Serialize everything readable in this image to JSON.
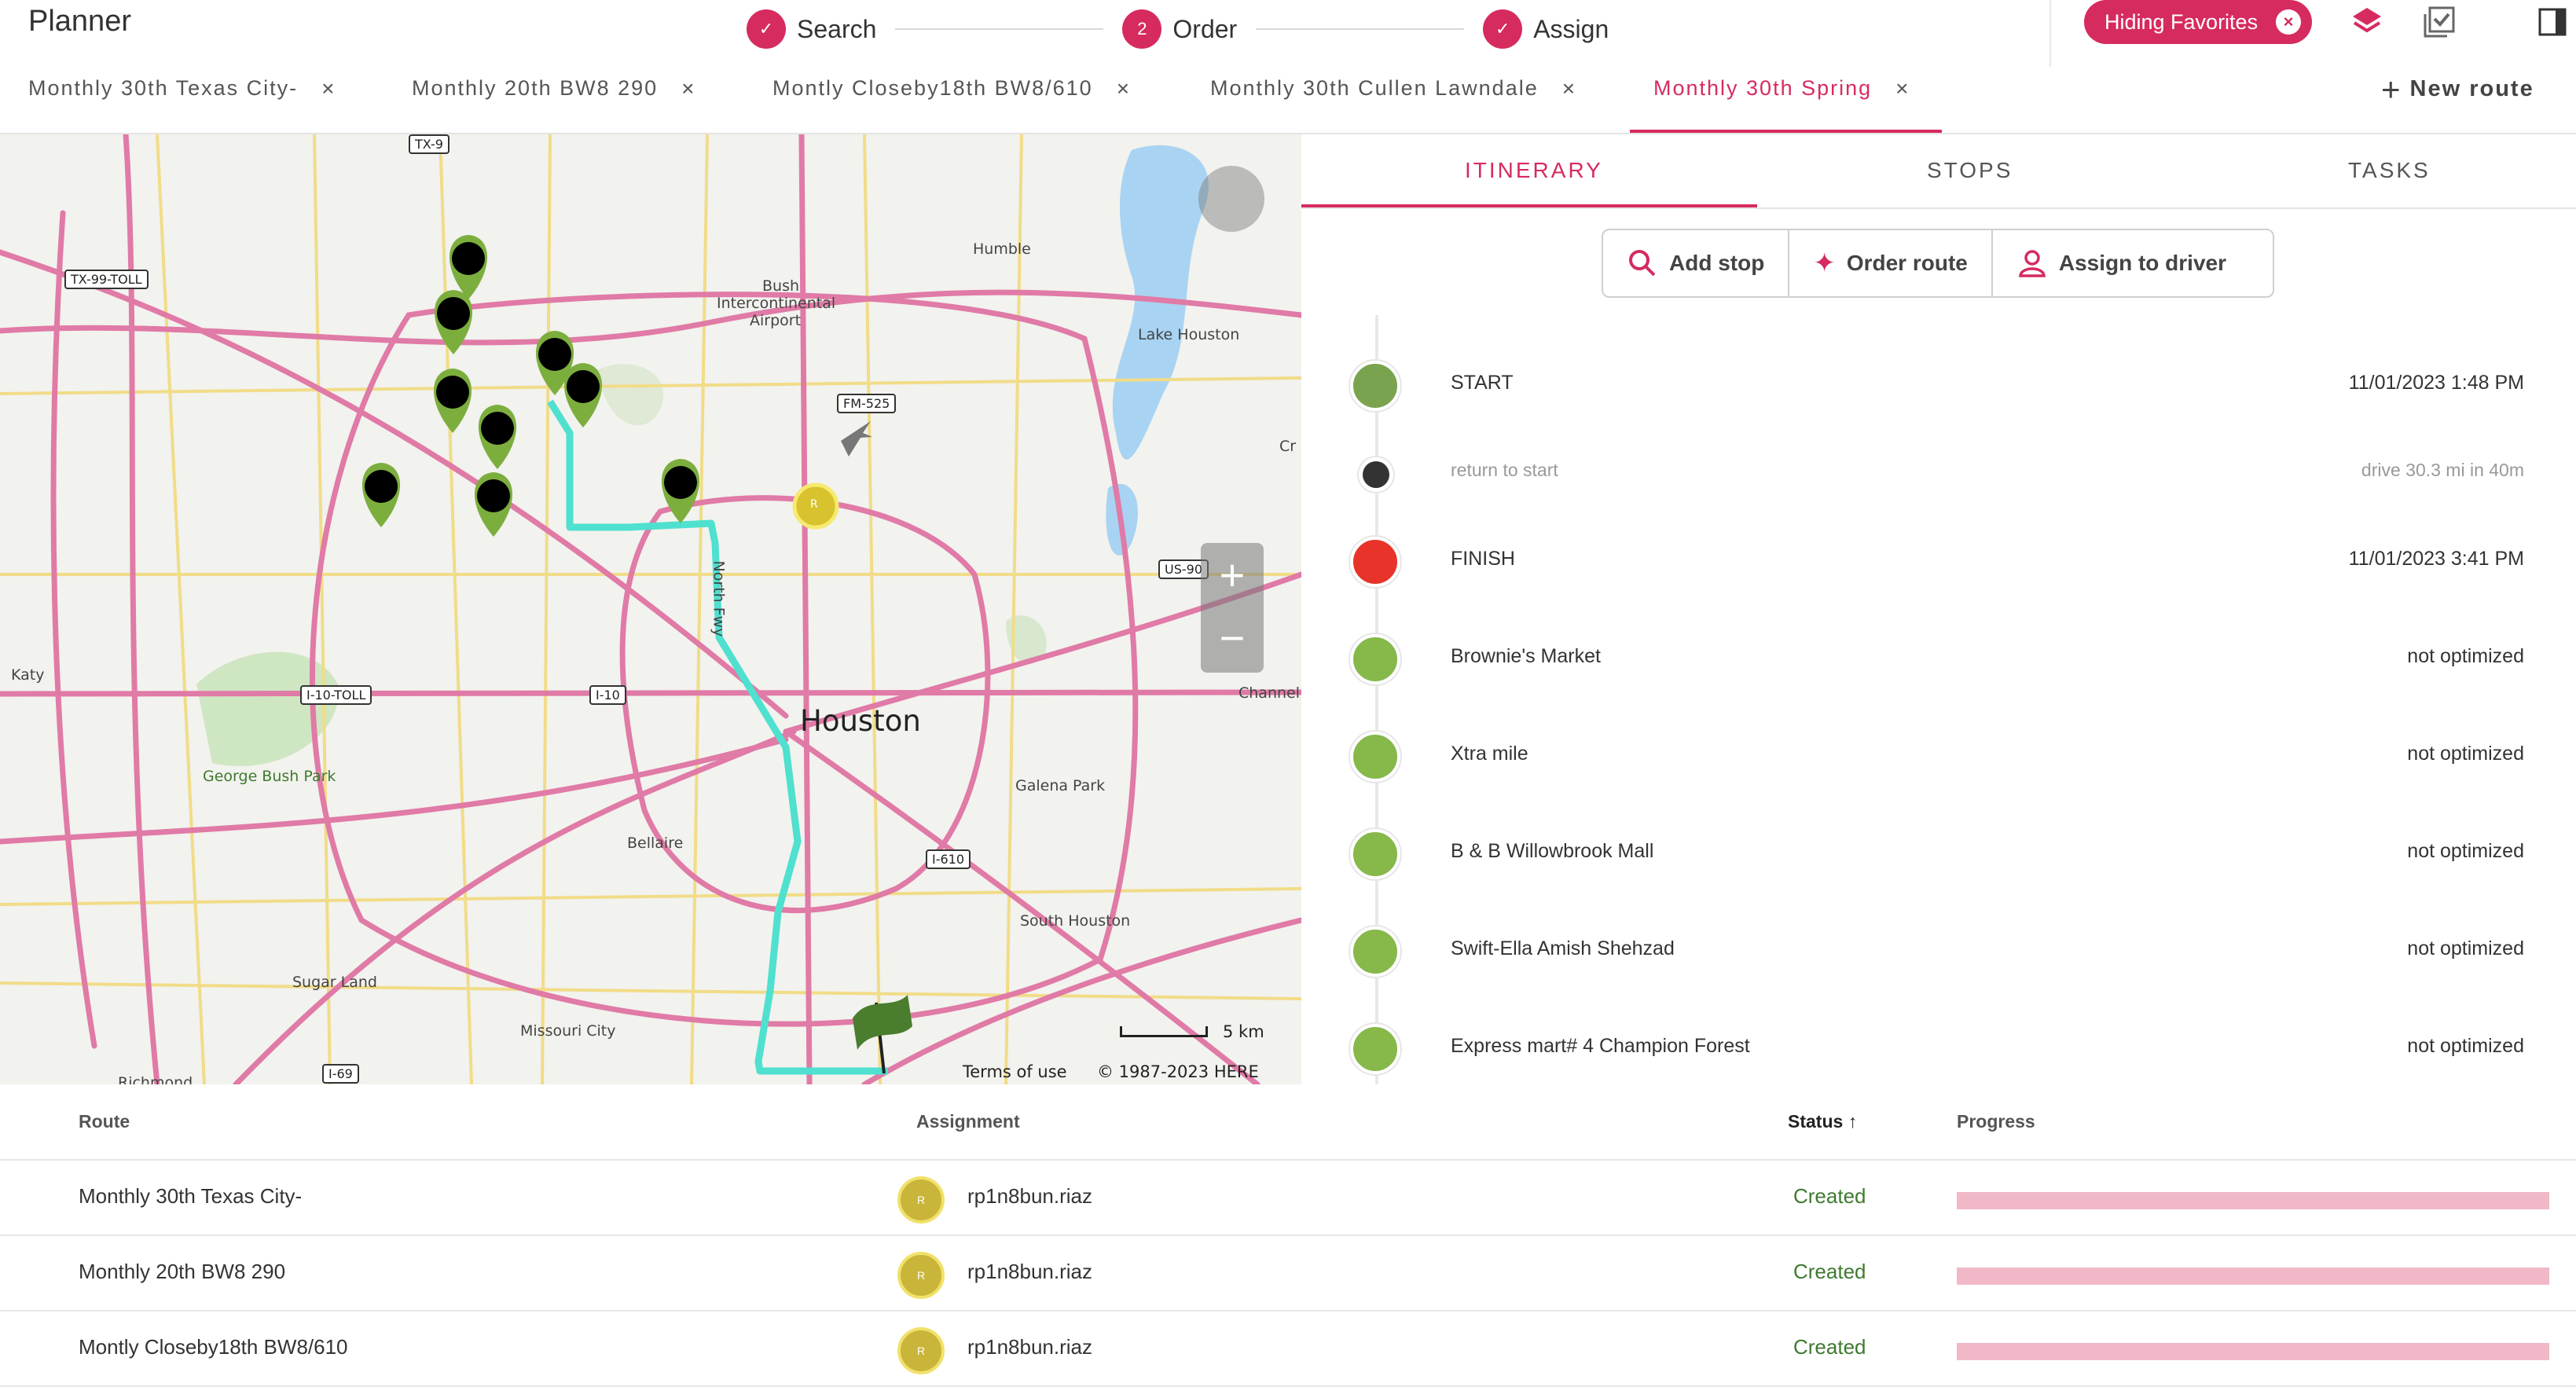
{
  "header": {
    "title": "Planner",
    "steps": [
      {
        "label": "Search",
        "badge": "✓",
        "state": "done"
      },
      {
        "label": "Order",
        "badge": "2",
        "state": "current"
      },
      {
        "label": "Assign",
        "badge": "✓",
        "state": "done"
      }
    ],
    "favorites_label": "Hiding Favorites",
    "icons": [
      "layers-icon",
      "checklist-icon",
      "panel-toggle-icon"
    ]
  },
  "route_tabs": [
    {
      "label": "Monthly 30th Texas City-",
      "active": false
    },
    {
      "label": "Monthly 20th BW8 290",
      "active": false
    },
    {
      "label": "Montly Closeby18th BW8/610",
      "active": false
    },
    {
      "label": "Monthly 30th Cullen Lawndale",
      "active": false
    },
    {
      "label": "Monthly 30th Spring",
      "active": true
    }
  ],
  "tab_close": "×",
  "new_route_label": "New route",
  "map": {
    "labels": {
      "houston": "Houston",
      "humble": "Humble",
      "bush": "Bush",
      "intercontinental": "Intercontinental",
      "airport": "Airport",
      "lake_houston": "Lake Houston",
      "katy": "Katy",
      "george_bush_park": "George Bush Park",
      "galena_park": "Galena Park",
      "bellaire": "Bellaire",
      "south_houston": "South Houston",
      "sugar_land": "Sugar Land",
      "missouri_city": "Missouri City",
      "richmond": "Richmond",
      "channelview": "Channel",
      "crosby": "Cr",
      "north_fwy": "North Fwy"
    },
    "shields": {
      "tx99": "TX-99-TOLL",
      "tx9": "TX-9",
      "fm525": "FM-525",
      "us90": "US-90",
      "i10toll": "I-10-TOLL",
      "i10": "I-10",
      "i610": "I-610",
      "i69": "I-69"
    },
    "marker_badge": "R",
    "terms": "Terms of use",
    "copyright": "© 1987-2023 HERE",
    "scale": "5 km",
    "watermark": "here",
    "zoom_in": "+",
    "zoom_out": "−"
  },
  "panel": {
    "tabs": [
      "ITINERARY",
      "STOPS",
      "TASKS"
    ],
    "actions": [
      {
        "label": "Add stop",
        "icon": "search-icon"
      },
      {
        "label": "Order route",
        "icon": "sparkle-icon"
      },
      {
        "label": "Assign to driver",
        "icon": "person-icon"
      }
    ],
    "stops": [
      {
        "name": "START",
        "info": "11/01/2023 1:48 PM",
        "kind": "start",
        "color": "#79a34e"
      },
      {
        "name": "return to start",
        "info": "drive 30.3 mi in 40m",
        "kind": "leg",
        "color": "#333333"
      },
      {
        "name": "FINISH",
        "info": "11/01/2023 3:41 PM",
        "kind": "finish",
        "color": "#e8332a"
      },
      {
        "name": "Brownie's Market",
        "info": "not optimized",
        "kind": "stop",
        "color": "#86b84a"
      },
      {
        "name": "Xtra mile",
        "info": "not optimized",
        "kind": "stop",
        "color": "#86b84a"
      },
      {
        "name": "B & B Willowbrook Mall",
        "info": "not optimized",
        "kind": "stop",
        "color": "#86b84a"
      },
      {
        "name": "Swift-Ella Amish Shehzad",
        "info": "not optimized",
        "kind": "stop",
        "color": "#86b84a"
      },
      {
        "name": "Express mart# 4 Champion Forest",
        "info": "not optimized",
        "kind": "stop",
        "color": "#86b84a"
      }
    ]
  },
  "table": {
    "headers": {
      "route": "Route",
      "assignment": "Assignment",
      "status": "Status",
      "progress": "Progress"
    },
    "sort_icon": "↑",
    "rows": [
      {
        "route": "Monthly 30th Texas City-",
        "avatar": "R",
        "assignee": "rp1n8bun.riaz",
        "status": "Created",
        "progress": 0
      },
      {
        "route": "Monthly 20th BW8 290",
        "avatar": "R",
        "assignee": "rp1n8bun.riaz",
        "status": "Created",
        "progress": 0
      },
      {
        "route": "Montly Closeby18th BW8/610",
        "avatar": "R",
        "assignee": "rp1n8bun.riaz",
        "status": "Created",
        "progress": 0
      }
    ]
  },
  "colors": {
    "accent": "#d62b5f",
    "status_created": "#3f7a30",
    "route_line": "#4fe0cf",
    "highway": "#e07aa6",
    "marker": "#7cae3e"
  }
}
